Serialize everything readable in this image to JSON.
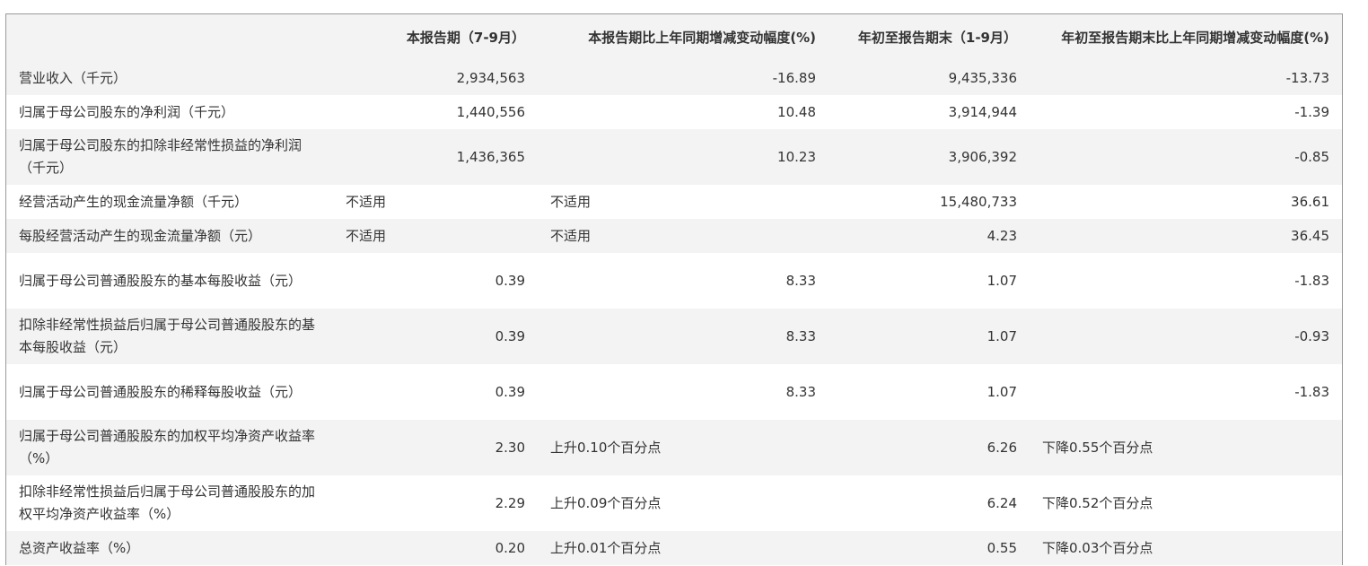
{
  "table": {
    "headers": [
      "",
      "本报告期（7-9月）",
      "本报告期比上年同期增减变动幅度(%)",
      "年初至报告期末（1-9月）",
      "年初至报告期末比上年同期增减变动幅度(%)"
    ],
    "rows": [
      {
        "label": "营业收入（千元）",
        "cells": [
          "2,934,563",
          "-16.89",
          "9,435,336",
          "-13.73"
        ]
      },
      {
        "label": "归属于母公司股东的净利润（千元）",
        "cells": [
          "1,440,556",
          "10.48",
          "3,914,944",
          "-1.39"
        ]
      },
      {
        "label": "归属于母公司股东的扣除非经常性损益的净利润（千元）",
        "cells": [
          "1,436,365",
          "10.23",
          "3,906,392",
          "-0.85"
        ]
      },
      {
        "label": "经营活动产生的现金流量净额（千元）",
        "cells": [
          "不适用",
          "不适用",
          "15,480,733",
          "36.61"
        ]
      },
      {
        "label": "每股经营活动产生的现金流量净额（元）",
        "cells": [
          "不适用",
          "不适用",
          "4.23",
          "36.45"
        ]
      },
      {
        "label": "归属于母公司普通股股东的基本每股收益（元）",
        "cells": [
          "0.39",
          "8.33",
          "1.07",
          "-1.83"
        ]
      },
      {
        "label": "扣除非经常性损益后归属于母公司普通股股东的基本每股收益（元）",
        "cells": [
          "0.39",
          "8.33",
          "1.07",
          "-0.93"
        ]
      },
      {
        "label": "归属于母公司普通股股东的稀释每股收益（元）",
        "cells": [
          "0.39",
          "8.33",
          "1.07",
          "-1.83"
        ]
      },
      {
        "label": "归属于母公司普通股股东的加权平均净资产收益率（%）",
        "cells": [
          "2.30",
          "上升0.10个百分点",
          "6.26",
          "下降0.55个百分点"
        ]
      },
      {
        "label": "扣除非经常性损益后归属于母公司普通股股东的加权平均净资产收益率（%）",
        "cells": [
          "2.29",
          "上升0.09个百分点",
          "6.24",
          "下降0.52个百分点"
        ]
      },
      {
        "label": "总资产收益率（%）",
        "cells": [
          "0.20",
          "上升0.01个百分点",
          "0.55",
          "下降0.03个百分点"
        ]
      }
    ]
  }
}
